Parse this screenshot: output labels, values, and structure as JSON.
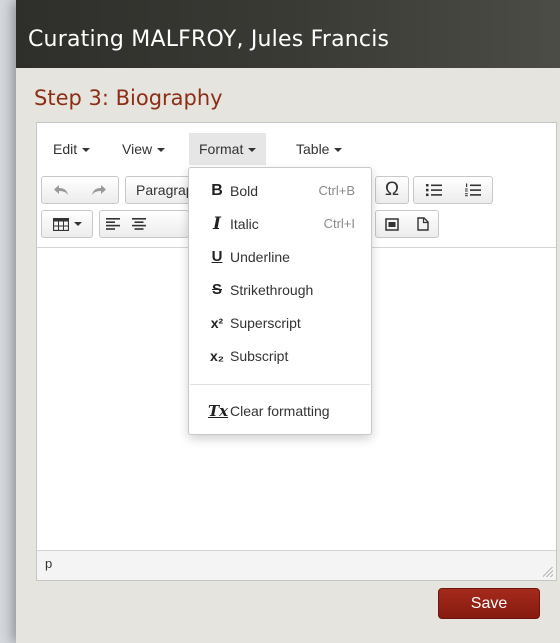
{
  "header": {
    "title": "Curating MALFROY, Jules Francis"
  },
  "step_title": "Step 3: Biography",
  "menubar": [
    {
      "label": "Edit"
    },
    {
      "label": "View"
    },
    {
      "label": "Format",
      "active": true
    },
    {
      "label": "Table"
    }
  ],
  "toolbar": {
    "undo_icon": "undo-icon",
    "redo_icon": "redo-icon",
    "paragraph_label": "Paragraph",
    "special_char_icon": "omega-icon",
    "bullet_list_icon": "bullet-list-icon",
    "numbered_list_icon": "numbered-list-icon",
    "table_icon": "table-icon",
    "align_left_icon": "align-left-icon",
    "align_center_icon": "align-center-icon",
    "image_icon": "image-icon",
    "document_icon": "new-document-icon"
  },
  "format_menu": {
    "items": [
      {
        "icon": "B",
        "label": "Bold",
        "shortcut": "Ctrl+B"
      },
      {
        "icon": "I",
        "label": "Italic",
        "shortcut": "Ctrl+I"
      },
      {
        "icon": "U",
        "label": "Underline",
        "shortcut": ""
      },
      {
        "icon": "S",
        "label": "Strikethrough",
        "shortcut": ""
      },
      {
        "icon": "x²",
        "label": "Superscript",
        "shortcut": ""
      },
      {
        "icon": "x₂",
        "label": "Subscript",
        "shortcut": ""
      }
    ],
    "clear": {
      "icon": "Tx",
      "label": "Clear formatting"
    }
  },
  "statusbar": {
    "path": "p"
  },
  "actions": {
    "save_label": "Save"
  },
  "colors": {
    "accent": "#8c2e14",
    "save_button": "#9c2415",
    "header_bg": "#333330"
  }
}
